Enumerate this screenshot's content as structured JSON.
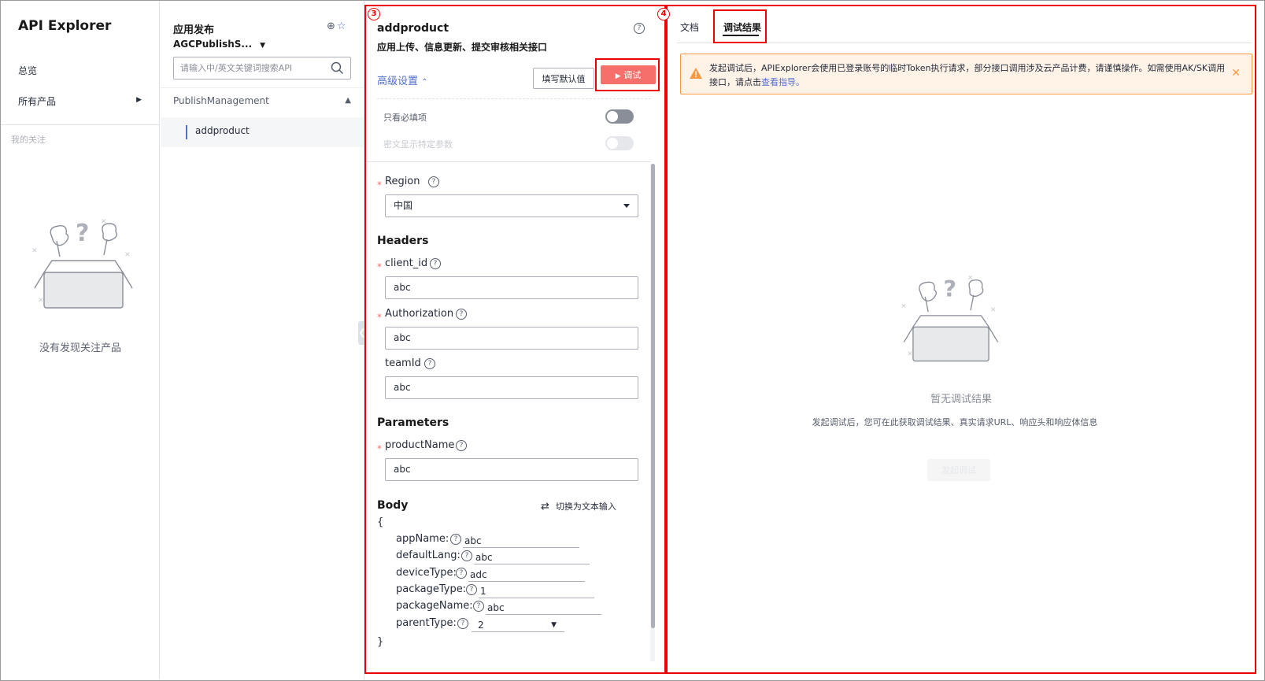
{
  "sidebar": {
    "title": "API Explorer",
    "items": [
      {
        "label": "总览"
      },
      {
        "label": "所有产品"
      }
    ],
    "favorites_title": "我的关注",
    "favorites_empty": "没有发现关注产品"
  },
  "api_list": {
    "category_title": "应用发布",
    "product": "AGCPublishS...",
    "search_placeholder": "请输入中/英文关键词搜索API",
    "group": "PublishManagement",
    "items": [
      {
        "label": "addproduct"
      }
    ]
  },
  "debug_panel": {
    "marker": "3",
    "api_name": "addproduct",
    "api_description": "应用上传、信息更新、提交审核相关接口",
    "advanced_label": "高级设置",
    "fill_default_label": "填写默认值",
    "debug_button_label": "调试",
    "toggles": [
      {
        "label": "只看必填项",
        "on": false,
        "disabled": false
      },
      {
        "label": "密文显示特定参数",
        "on": false,
        "disabled": true
      }
    ],
    "region": {
      "label": "Region",
      "value": "中国",
      "required": true
    },
    "headers_title": "Headers",
    "headers": [
      {
        "label": "client_id",
        "value": "abc",
        "required": true
      },
      {
        "label": "Authorization",
        "value": "abc",
        "required": true
      },
      {
        "label": "teamId",
        "value": "abc",
        "required": false
      }
    ],
    "parameters_title": "Parameters",
    "parameters": [
      {
        "label": "productName",
        "value": "abc",
        "required": true
      }
    ],
    "body_title": "Body",
    "switch_text_label": "切换为文本输入",
    "body_open": "{",
    "body_close": "}",
    "body_fields": [
      {
        "key": "appName:",
        "value": "abc"
      },
      {
        "key": "defaultLang:",
        "value": "abc"
      },
      {
        "key": "deviceType:",
        "value": "adc"
      },
      {
        "key": "packageType:",
        "value": "1"
      },
      {
        "key": "packageName:",
        "value": "abc"
      },
      {
        "key": "parentType:",
        "value": "2"
      }
    ]
  },
  "result_panel": {
    "marker": "4",
    "tabs": [
      {
        "label": "文档",
        "active": false
      },
      {
        "label": "调试结果",
        "active": true
      }
    ],
    "alert_text": "发起调试后，APIExplorer会使用已登录账号的临时Token执行请求，部分接口调用涉及云产品计费，请谨慎操作。如需使用AK/SK调用接口，请点击",
    "alert_link": "查看指导。",
    "empty_title": "暂无调试结果",
    "empty_desc": "发起调试后，您可在此获取调试结果、真实请求URL、响应头和响应体信息",
    "start_button": "发起调试"
  },
  "colors": {
    "accent": "#526ecc",
    "debug_button": "#f66f6a",
    "annotation_red": "#e00000",
    "alert_bg": "#fff3e8",
    "alert_border": "#fa9841"
  }
}
